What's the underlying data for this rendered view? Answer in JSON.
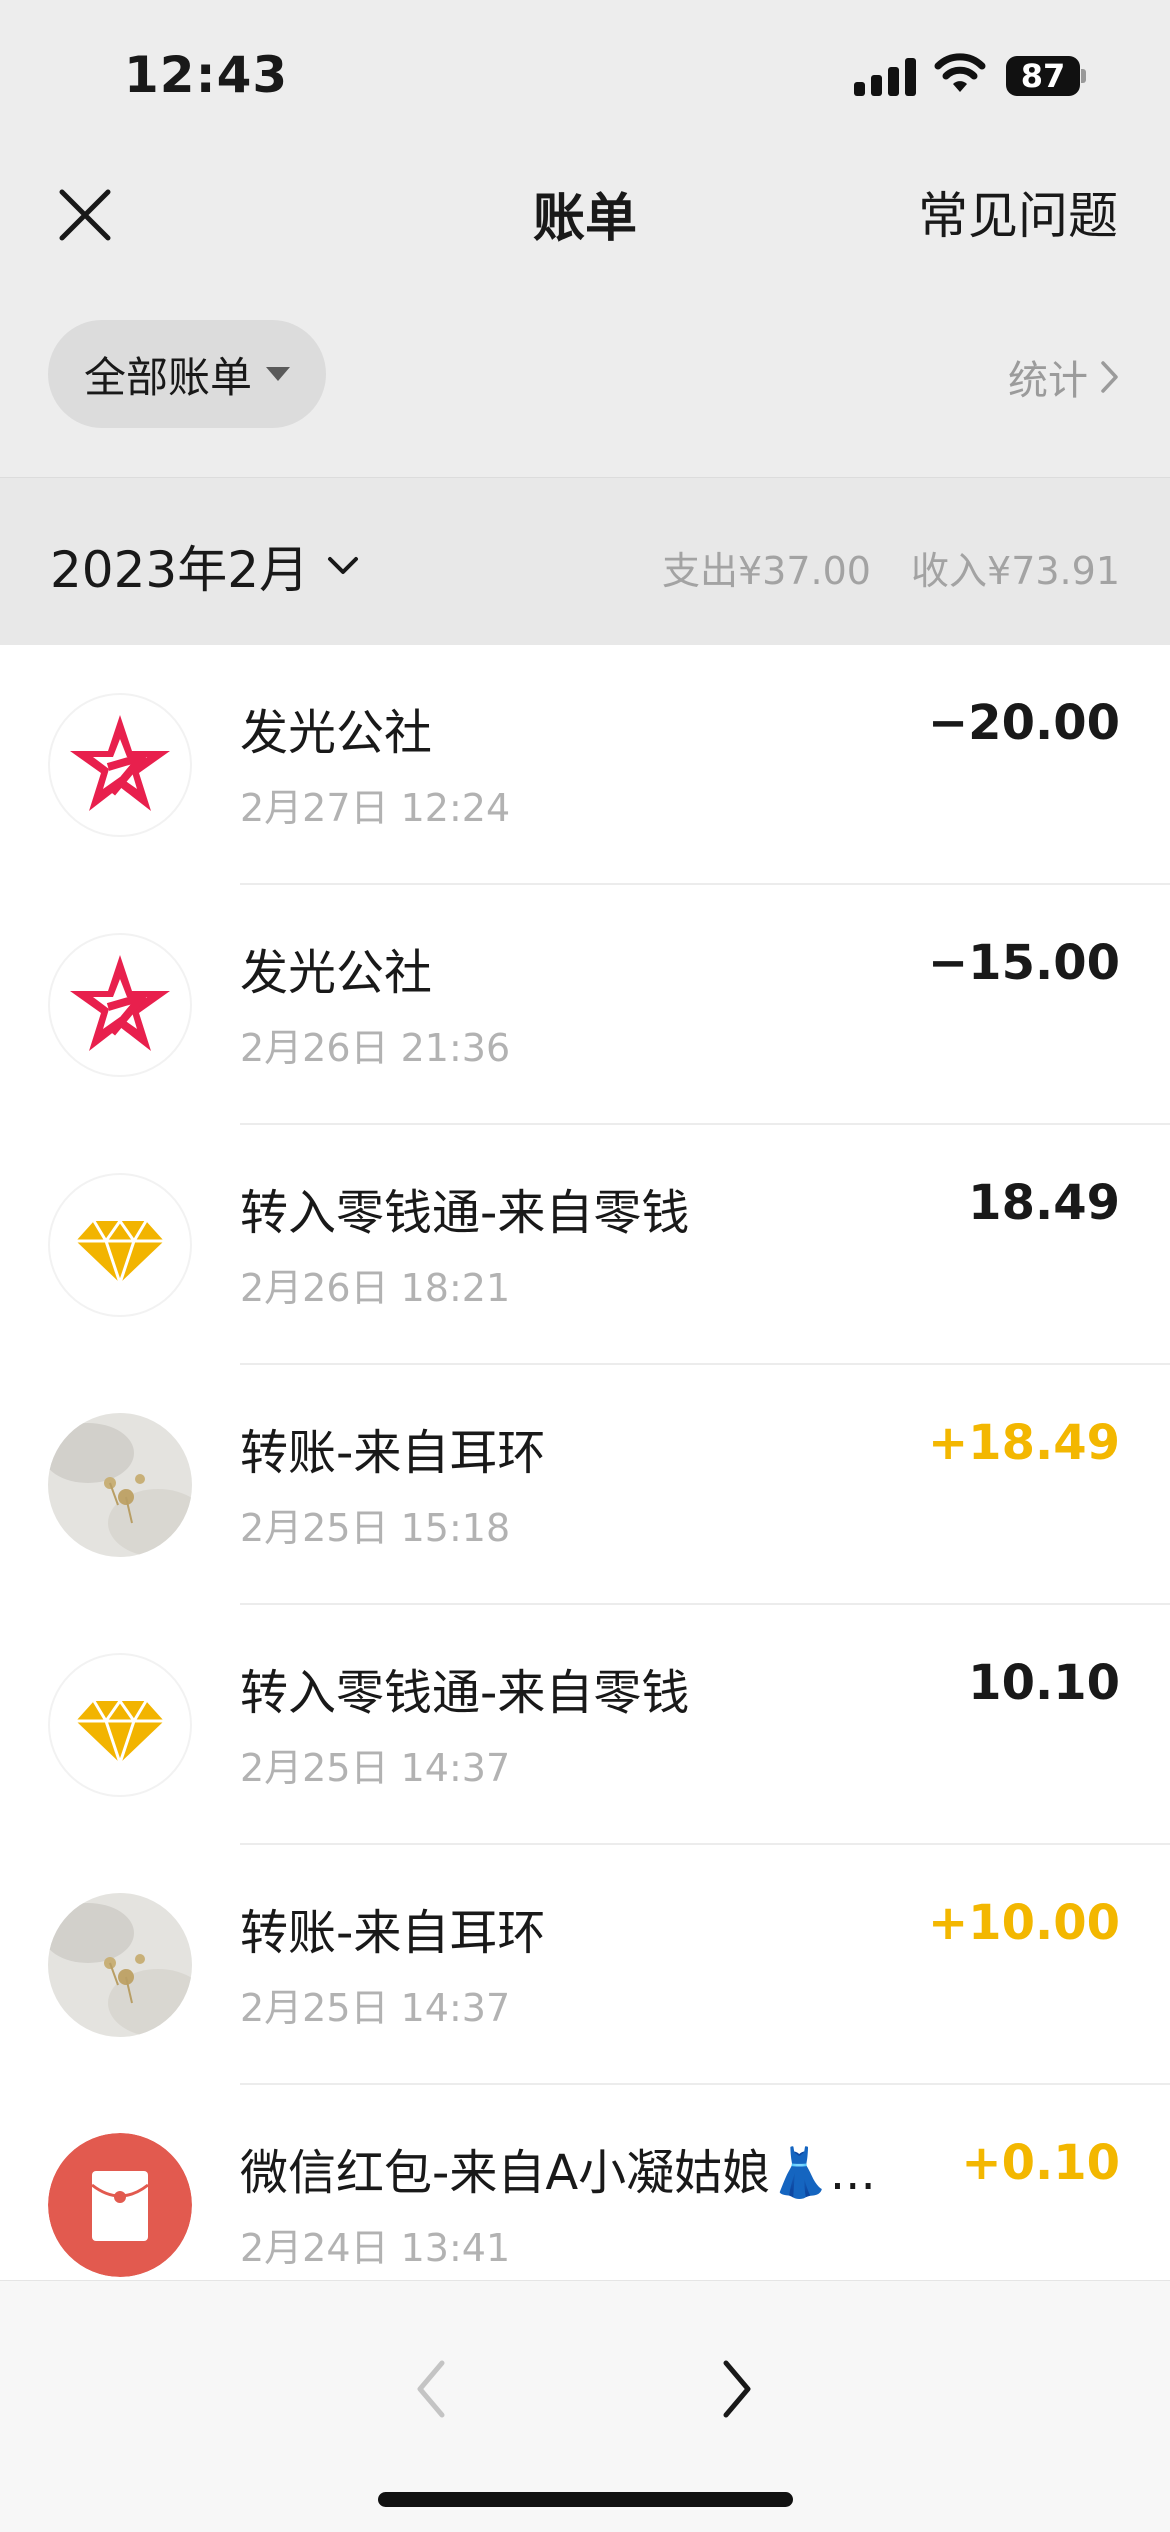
{
  "status": {
    "time": "12:43",
    "battery": "87"
  },
  "nav": {
    "title": "账单",
    "right_label": "常见问题"
  },
  "filter": {
    "label": "全部账单",
    "stats_label": "统计"
  },
  "month": {
    "label": "2023年2月",
    "expense": "支出¥37.00",
    "income": "收入¥73.91"
  },
  "transactions": [
    {
      "icon": "star-logo-icon",
      "title": "发光公社",
      "time": "2月27日 12:24",
      "amount": "−20.00",
      "type": "expense"
    },
    {
      "icon": "star-logo-icon",
      "title": "发光公社",
      "time": "2月26日 21:36",
      "amount": "−15.00",
      "type": "expense"
    },
    {
      "icon": "diamond-icon",
      "title": "转入零钱通-来自零钱",
      "time": "2月26日 18:21",
      "amount": "18.49",
      "type": "neutral"
    },
    {
      "icon": "earring-photo-avatar",
      "title": "转账-来自耳环",
      "time": "2月25日 15:18",
      "amount": "+18.49",
      "type": "income"
    },
    {
      "icon": "diamond-icon",
      "title": "转入零钱通-来自零钱",
      "time": "2月25日 14:37",
      "amount": "10.10",
      "type": "neutral"
    },
    {
      "icon": "earring-photo-avatar",
      "title": "转账-来自耳环",
      "time": "2月25日 14:37",
      "amount": "+10.00",
      "type": "income"
    },
    {
      "icon": "red-packet-icon",
      "title": "微信红包-来自A小凝姑娘👗...",
      "time": "2月24日 13:41",
      "amount": "+0.10",
      "type": "income"
    }
  ],
  "colors": {
    "income": "#f3b700",
    "star": "#e8204d",
    "diamond": "#f2b400",
    "red_packet": "#e25a4f"
  }
}
